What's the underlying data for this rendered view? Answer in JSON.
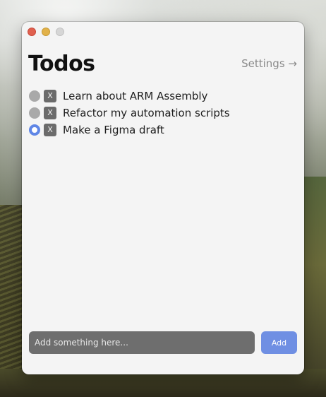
{
  "app": {
    "title": "Todos",
    "settings_label": "Settings →"
  },
  "todos": [
    {
      "text": "Learn about ARM Assembly",
      "completed": false,
      "delete_label": "X"
    },
    {
      "text": "Refactor my automation scripts",
      "completed": false,
      "delete_label": "X"
    },
    {
      "text": "Make a Figma draft",
      "completed": true,
      "delete_label": "X"
    }
  ],
  "composer": {
    "placeholder": "Add something here...",
    "value": "",
    "add_label": "Add"
  },
  "colors": {
    "accent": "#6f8fe3",
    "checked_radio": "#5f86e6",
    "unchecked_radio": "#a9a9a9",
    "window_bg": "#f4f4f4"
  }
}
